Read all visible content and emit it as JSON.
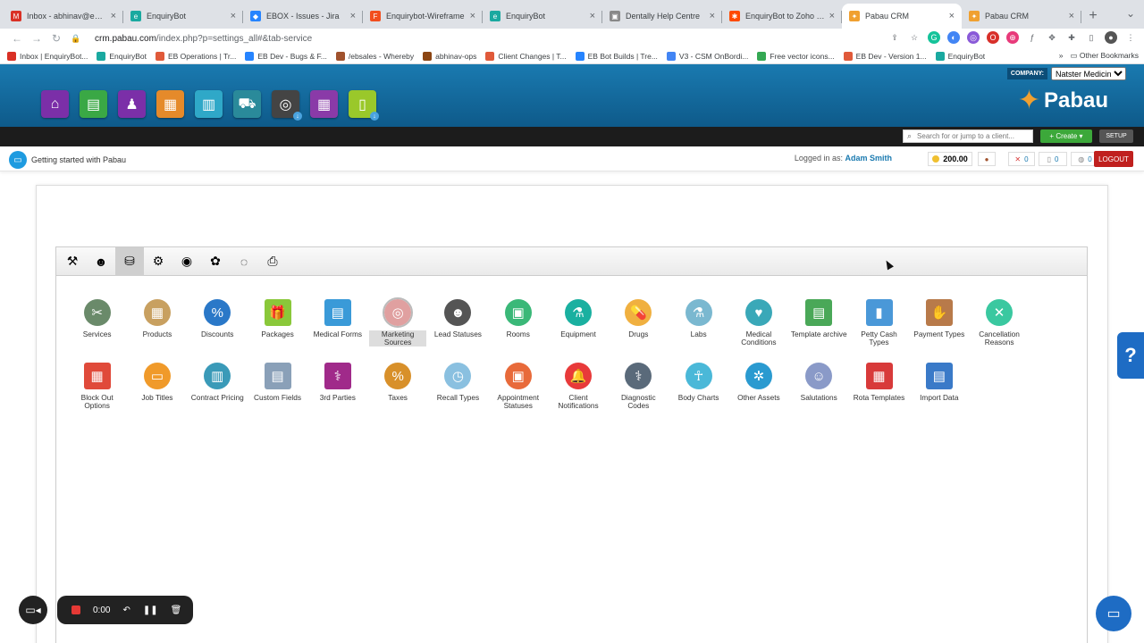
{
  "browser": {
    "tabs": [
      {
        "title": "Inbox - abhinav@enquiryb",
        "icon": "gmail-icon",
        "color": "#d93025",
        "glyph": "M"
      },
      {
        "title": "EnquiryBot",
        "icon": "enquirybot-icon",
        "color": "#1aa9a0",
        "glyph": "e"
      },
      {
        "title": "EBOX - Issues - Jira",
        "icon": "jira-icon",
        "color": "#2684ff",
        "glyph": "◆"
      },
      {
        "title": "Enquirybot-Wireframe",
        "icon": "figma-icon",
        "color": "#f24e1e",
        "glyph": "F"
      },
      {
        "title": "EnquiryBot",
        "icon": "enquirybot-icon",
        "color": "#1aa9a0",
        "glyph": "e"
      },
      {
        "title": "Dentally Help Centre",
        "icon": "dentally-icon",
        "color": "#888888",
        "glyph": "▣"
      },
      {
        "title": "EnquiryBot to Zoho | Za",
        "icon": "zapier-icon",
        "color": "#ff4a00",
        "glyph": "✱"
      },
      {
        "title": "Pabau CRM",
        "icon": "pabau-icon",
        "color": "#f0a030",
        "glyph": "✦",
        "active": true
      },
      {
        "title": "Pabau CRM",
        "icon": "pabau-icon",
        "color": "#f0a030",
        "glyph": "✦"
      }
    ],
    "url_host": "crm.pabau.com",
    "url_path": "/index.php?p=settings_all#&tab-service",
    "bookmarks": [
      {
        "label": "Inbox | EnquiryBot...",
        "color": "#d93025"
      },
      {
        "label": "EnquiryBot",
        "color": "#1aa9a0"
      },
      {
        "label": "EB Operations | Tr...",
        "color": "#e05a3a"
      },
      {
        "label": "EB Dev - Bugs & F...",
        "color": "#2684ff"
      },
      {
        "label": "/ebsales - Whereby",
        "color": "#a0522d"
      },
      {
        "label": "abhinav-ops",
        "color": "#8b4513"
      },
      {
        "label": "Client Changes | T...",
        "color": "#e05a3a"
      },
      {
        "label": "EB Bot Builds | Tre...",
        "color": "#2684ff"
      },
      {
        "label": "V3 - CSM OnBordi...",
        "color": "#4285f4"
      },
      {
        "label": "Free vector icons...",
        "color": "#34a853"
      },
      {
        "label": "EB Dev - Version 1...",
        "color": "#e05a3a"
      },
      {
        "label": "EnquiryBot",
        "color": "#1aa9a0"
      }
    ],
    "other_bookmarks": "Other Bookmarks"
  },
  "header": {
    "company_label": "COMPANY:",
    "company_value": "Natster Medicine",
    "brand": "Pabau",
    "modules": [
      {
        "name": "home-module-icon",
        "color": "#7b2fa8",
        "glyph": "⌂"
      },
      {
        "name": "reports-module-icon",
        "color": "#3aa845",
        "glyph": "▤"
      },
      {
        "name": "staff-module-icon",
        "color": "#7b2fa8",
        "glyph": "♟"
      },
      {
        "name": "finance-module-icon",
        "color": "#e58a2a",
        "glyph": "▦"
      },
      {
        "name": "stock-module-icon",
        "color": "#2fa8c8",
        "glyph": "▥"
      },
      {
        "name": "shop-module-icon",
        "color": "#2a8a9a",
        "glyph": "⛟"
      },
      {
        "name": "marketing-module-icon",
        "color": "#444444",
        "glyph": "◎",
        "download": true
      },
      {
        "name": "calendar-module-icon",
        "color": "#8a3aa8",
        "glyph": "▦"
      },
      {
        "name": "leads-module-icon",
        "color": "#9ac82a",
        "glyph": "▯",
        "download": true
      }
    ]
  },
  "toolbar": {
    "search_placeholder": "Search for or jump to a client...",
    "create_label": "+ Create ▾",
    "setup_label": "SETUP"
  },
  "statusbar": {
    "getting_started": "Getting started with Pabau",
    "logged_in_label": "Logged in as:",
    "user_name": "Adam Smith",
    "credit": "200.00",
    "stat_pins": "0",
    "stat_docs": "0",
    "stat_globe": "0",
    "logout_label": "LOGOUT"
  },
  "settings": {
    "category_tabs": [
      {
        "name": "tab-general-icon",
        "glyph": "⚒"
      },
      {
        "name": "tab-users-icon",
        "glyph": "☻"
      },
      {
        "name": "tab-services-icon",
        "glyph": "⛁",
        "active": true
      },
      {
        "name": "tab-integrations-icon",
        "glyph": "⚙"
      },
      {
        "name": "tab-marketing-icon",
        "glyph": "◉"
      },
      {
        "name": "tab-apps-icon",
        "glyph": "✿"
      },
      {
        "name": "tab-forms-icon",
        "glyph": "◌"
      },
      {
        "name": "tab-printer-icon",
        "glyph": "⎙"
      }
    ],
    "items": [
      {
        "label": "Services",
        "icon": "services-icon",
        "color": "#6a8a6a",
        "glyph": "✂"
      },
      {
        "label": "Products",
        "icon": "products-icon",
        "color": "#c8a060",
        "glyph": "▦"
      },
      {
        "label": "Discounts",
        "icon": "discounts-icon",
        "color": "#2a78c8",
        "glyph": "%"
      },
      {
        "label": "Packages",
        "icon": "packages-icon",
        "color": "#8ac83a",
        "glyph": "🎁",
        "square": true
      },
      {
        "label": "Medical Forms",
        "icon": "medical-forms-icon",
        "color": "#3a9ad8",
        "glyph": "▤",
        "square": true
      },
      {
        "label": "Marketing Sources",
        "icon": "marketing-sources-icon",
        "color": "#e0a0a0",
        "glyph": "◎",
        "selected": true
      },
      {
        "label": "Lead Statuses",
        "icon": "lead-statuses-icon",
        "color": "#555555",
        "glyph": "☻"
      },
      {
        "label": "Rooms",
        "icon": "rooms-icon",
        "color": "#3ab878",
        "glyph": "▣"
      },
      {
        "label": "Equipment",
        "icon": "equipment-icon",
        "color": "#1ab0a0",
        "glyph": "⚗"
      },
      {
        "label": "Drugs",
        "icon": "drugs-icon",
        "color": "#f0b040",
        "glyph": "💊"
      },
      {
        "label": "Labs",
        "icon": "labs-icon",
        "color": "#7ab8d0",
        "glyph": "⚗"
      },
      {
        "label": "Medical Conditions",
        "icon": "medical-conditions-icon",
        "color": "#3aa8b8",
        "glyph": "♥"
      },
      {
        "label": "Template archive",
        "icon": "template-archive-icon",
        "color": "#4aa858",
        "glyph": "▤",
        "square": true
      },
      {
        "label": "Petty Cash Types",
        "icon": "petty-cash-types-icon",
        "color": "#4a98d8",
        "glyph": "▮",
        "square": true
      },
      {
        "label": "Payment Types",
        "icon": "payment-types-icon",
        "color": "#b87a4a",
        "glyph": "✋",
        "square": true
      },
      {
        "label": "Cancellation Reasons",
        "icon": "cancellation-reasons-icon",
        "color": "#3ac8a0",
        "glyph": "✕"
      },
      {
        "label": "Block Out Options",
        "icon": "block-out-options-icon",
        "color": "#e04a3a",
        "glyph": "▦",
        "square": true
      },
      {
        "label": "Job Titles",
        "icon": "job-titles-icon",
        "color": "#f09a2a",
        "glyph": "▭"
      },
      {
        "label": "Contract Pricing",
        "icon": "contract-pricing-icon",
        "color": "#3a9ab8",
        "glyph": "▥"
      },
      {
        "label": "Custom Fields",
        "icon": "custom-fields-icon",
        "color": "#8aa0b8",
        "glyph": "▤",
        "square": true
      },
      {
        "label": "3rd Parties",
        "icon": "third-parties-icon",
        "color": "#a02a8a",
        "glyph": "⚕",
        "square": true
      },
      {
        "label": "Taxes",
        "icon": "taxes-icon",
        "color": "#d8902a",
        "glyph": "%"
      },
      {
        "label": "Recall Types",
        "icon": "recall-types-icon",
        "color": "#8ac0e0",
        "glyph": "◷"
      },
      {
        "label": "Appointment Statuses",
        "icon": "appointment-statuses-icon",
        "color": "#e86a3a",
        "glyph": "▣"
      },
      {
        "label": "Client Notifications",
        "icon": "client-notifications-icon",
        "color": "#e83a3a",
        "glyph": "🔔"
      },
      {
        "label": "Diagnostic Codes",
        "icon": "diagnostic-codes-icon",
        "color": "#5a6a7a",
        "glyph": "⚕"
      },
      {
        "label": "Body Charts",
        "icon": "body-charts-icon",
        "color": "#4ab8d8",
        "glyph": "☥"
      },
      {
        "label": "Other Assets",
        "icon": "other-assets-icon",
        "color": "#2a9ad0",
        "glyph": "✲"
      },
      {
        "label": "Salutations",
        "icon": "salutations-icon",
        "color": "#8a9ac8",
        "glyph": "☺"
      },
      {
        "label": "Rota Templates",
        "icon": "rota-templates-icon",
        "color": "#d83a3a",
        "glyph": "▦",
        "square": true
      },
      {
        "label": "Import Data",
        "icon": "import-data-icon",
        "color": "#3a7ac8",
        "glyph": "▤",
        "square": true
      }
    ]
  },
  "recorder": {
    "time": "0:00"
  },
  "help_glyph": "?"
}
